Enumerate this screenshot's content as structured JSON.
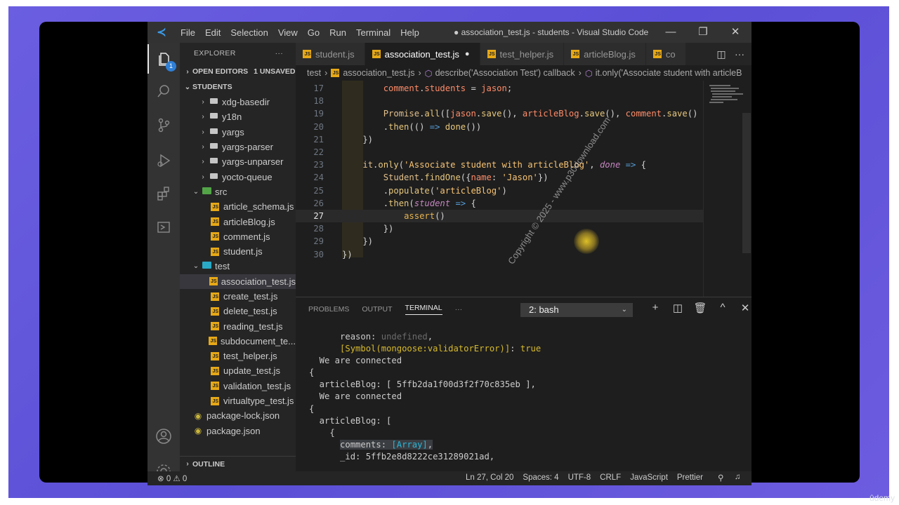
{
  "window": {
    "title": "● association_test.js - students - Visual Studio Code",
    "menu": [
      "File",
      "Edit",
      "Selection",
      "View",
      "Go",
      "Run",
      "Terminal",
      "Help"
    ],
    "controls": [
      "—",
      "❐",
      "✕"
    ]
  },
  "activity_bar": {
    "explorer_badge": "1",
    "items": [
      "explorer-icon",
      "search-icon",
      "source-control-icon",
      "run-debug-icon",
      "extensions-icon",
      "remote-icon"
    ],
    "bottom": [
      "account-icon",
      "settings-gear-icon"
    ]
  },
  "sidebar": {
    "title": "EXPLORER",
    "more": "···",
    "open_editors": "OPEN EDITORS",
    "unsaved": "1 UNSAVED",
    "project": "STUDENTS",
    "tree": [
      {
        "label": "xdg-basedir",
        "kind": "folder",
        "indent": 2
      },
      {
        "label": "y18n",
        "kind": "folder",
        "indent": 2
      },
      {
        "label": "yargs",
        "kind": "folder",
        "indent": 2
      },
      {
        "label": "yargs-parser",
        "kind": "folder",
        "indent": 2
      },
      {
        "label": "yargs-unparser",
        "kind": "folder",
        "indent": 2
      },
      {
        "label": "yocto-queue",
        "kind": "folder",
        "indent": 2
      },
      {
        "label": "src",
        "kind": "src-open",
        "indent": 1
      },
      {
        "label": "article_schema.js",
        "kind": "js",
        "indent": 2
      },
      {
        "label": "articleBlog.js",
        "kind": "js",
        "indent": 2
      },
      {
        "label": "comment.js",
        "kind": "js",
        "indent": 2
      },
      {
        "label": "student.js",
        "kind": "js",
        "indent": 2
      },
      {
        "label": "test",
        "kind": "test-open",
        "indent": 1
      },
      {
        "label": "association_test.js",
        "kind": "js",
        "indent": 2,
        "selected": true
      },
      {
        "label": "create_test.js",
        "kind": "js",
        "indent": 2
      },
      {
        "label": "delete_test.js",
        "kind": "js",
        "indent": 2
      },
      {
        "label": "reading_test.js",
        "kind": "js",
        "indent": 2
      },
      {
        "label": "subdocument_te...",
        "kind": "js",
        "indent": 2
      },
      {
        "label": "test_helper.js",
        "kind": "js",
        "indent": 2
      },
      {
        "label": "update_test.js",
        "kind": "js",
        "indent": 2
      },
      {
        "label": "validation_test.js",
        "kind": "js",
        "indent": 2
      },
      {
        "label": "virtualtype_test.js",
        "kind": "js",
        "indent": 2
      },
      {
        "label": "package-lock.json",
        "kind": "json",
        "indent": 1
      },
      {
        "label": "package.json",
        "kind": "json",
        "indent": 1
      }
    ],
    "outline": "OUTLINE"
  },
  "tabs": [
    {
      "label": "student.js",
      "active": false,
      "dirty": false
    },
    {
      "label": "association_test.js",
      "active": true,
      "dirty": true
    },
    {
      "label": "test_helper.js",
      "active": false,
      "dirty": false
    },
    {
      "label": "articleBlog.js",
      "active": false,
      "dirty": false
    },
    {
      "label": "co",
      "active": false,
      "dirty": false
    }
  ],
  "tab_actions": [
    "split-editor-icon",
    "more-icon"
  ],
  "breadcrumb": {
    "folder": "test",
    "file": "association_test.js",
    "scope1": "describe('Association Test') callback",
    "scope2": "it.only('Associate student with articleB"
  },
  "editor": {
    "current_line": 27,
    "lines": [
      {
        "n": "17",
        "tokens": [
          [
            "        ",
            ""
          ],
          [
            "comment",
            "k-red"
          ],
          [
            ".",
            ""
          ],
          [
            "students",
            "k-red"
          ],
          [
            " = ",
            ""
          ],
          [
            "jason",
            "k-red"
          ],
          [
            ";",
            ""
          ]
        ]
      },
      {
        "n": "18",
        "tokens": []
      },
      {
        "n": "19",
        "tokens": [
          [
            "        ",
            ""
          ],
          [
            "Promise",
            "k-var"
          ],
          [
            ".",
            ""
          ],
          [
            "all",
            "k-fn"
          ],
          [
            "([",
            ""
          ],
          [
            "jason",
            "k-red"
          ],
          [
            ".",
            ""
          ],
          [
            "save",
            "k-fn"
          ],
          [
            "(), ",
            ""
          ],
          [
            "articleBlog",
            "k-red"
          ],
          [
            ".",
            ""
          ],
          [
            "save",
            "k-fn"
          ],
          [
            "(), ",
            ""
          ],
          [
            "comment",
            "k-red"
          ],
          [
            ".",
            ""
          ],
          [
            "save",
            "k-fn"
          ],
          [
            "()",
            ""
          ]
        ]
      },
      {
        "n": "20",
        "tokens": [
          [
            "        .",
            ""
          ],
          [
            "then",
            "k-fn"
          ],
          [
            "(() ",
            ""
          ],
          [
            "=>",
            "k-kw"
          ],
          [
            " ",
            ""
          ],
          [
            "done",
            "k-fn"
          ],
          [
            "())",
            ""
          ]
        ]
      },
      {
        "n": "21",
        "tokens": [
          [
            "    })",
            ""
          ]
        ]
      },
      {
        "n": "22",
        "tokens": []
      },
      {
        "n": "23",
        "tokens": [
          [
            "    ",
            ""
          ],
          [
            "it",
            "k-var"
          ],
          [
            ".",
            ""
          ],
          [
            "only",
            "k-fn"
          ],
          [
            "(",
            ""
          ],
          [
            "'Associate student with articleBlog'",
            "k-str"
          ],
          [
            ", ",
            ""
          ],
          [
            "done",
            "k-param"
          ],
          [
            " ",
            ""
          ],
          [
            "=>",
            "k-kw"
          ],
          [
            " {",
            ""
          ]
        ]
      },
      {
        "n": "24",
        "tokens": [
          [
            "        ",
            ""
          ],
          [
            "Student",
            "k-var"
          ],
          [
            ".",
            ""
          ],
          [
            "findOne",
            "k-fn"
          ],
          [
            "({",
            ""
          ],
          [
            "name",
            "k-red"
          ],
          [
            ": ",
            ""
          ],
          [
            "'Jason'",
            "k-str"
          ],
          [
            "})",
            ""
          ]
        ]
      },
      {
        "n": "25",
        "tokens": [
          [
            "        .",
            ""
          ],
          [
            "populate",
            "k-fn"
          ],
          [
            "(",
            ""
          ],
          [
            "'articleBlog'",
            "k-str"
          ],
          [
            ")",
            ""
          ]
        ]
      },
      {
        "n": "26",
        "tokens": [
          [
            "        .",
            ""
          ],
          [
            "then",
            "k-fn"
          ],
          [
            "(",
            ""
          ],
          [
            "student",
            "k-param"
          ],
          [
            " ",
            ""
          ],
          [
            "=>",
            "k-kw"
          ],
          [
            " {",
            ""
          ]
        ]
      },
      {
        "n": "27",
        "tokens": [
          [
            "            ",
            ""
          ],
          [
            "assert",
            "k-fn2"
          ],
          [
            "()",
            ""
          ]
        ]
      },
      {
        "n": "28",
        "tokens": [
          [
            "        })",
            ""
          ]
        ]
      },
      {
        "n": "29",
        "tokens": [
          [
            "    })",
            ""
          ]
        ]
      },
      {
        "n": "30",
        "tokens": [
          [
            "})",
            ""
          ]
        ]
      }
    ]
  },
  "panel": {
    "tabs": [
      "PROBLEMS",
      "OUTPUT",
      "TERMINAL",
      "···"
    ],
    "active_tab": "TERMINAL",
    "terminal_select": "2: bash",
    "actions": [
      "+",
      "◫",
      "🗑",
      "^",
      "✕"
    ],
    "terminal_lines": [
      [
        [
          "      reason: ",
          ""
        ],
        [
          "undefined",
          "t-gray"
        ],
        [
          ",",
          ""
        ]
      ],
      [
        [
          "      ",
          ""
        ],
        [
          "[Symbol(mongoose:validatorError)]",
          "t-yellow"
        ],
        [
          ": ",
          ""
        ],
        [
          "true",
          "t-yellow"
        ]
      ],
      [
        [
          "  We are connected",
          ""
        ]
      ],
      [
        [
          "{",
          ""
        ]
      ],
      [
        [
          "  articleBlog: [ ",
          ""
        ],
        [
          "5ffb2da1f00d3f2f70c835eb",
          ""
        ],
        [
          " ],",
          ""
        ]
      ],
      [
        [
          "  We are connected",
          ""
        ]
      ],
      [
        [
          "{",
          ""
        ]
      ],
      [
        [
          "  articleBlog: [",
          ""
        ]
      ],
      [
        [
          "    {",
          ""
        ]
      ],
      [
        [
          "      ",
          ""
        ],
        [
          "comments: ",
          "t-sel"
        ],
        [
          "[Array]",
          "t-cyan t-sel"
        ],
        [
          ",",
          "t-sel"
        ]
      ],
      [
        [
          "      _id: 5ffb2e8d8222ce31289021ad,",
          ""
        ]
      ]
    ]
  },
  "status_bar": {
    "problems": "⊗ 0 ⚠ 0",
    "items": [
      "Ln 27, Col 20",
      "Spaces: 4",
      "UTF-8",
      "CRLF",
      "JavaScript",
      "Prettier"
    ]
  },
  "watermark": "Copyright © 2025 - www.p30download.com",
  "brand": "ûdemy"
}
